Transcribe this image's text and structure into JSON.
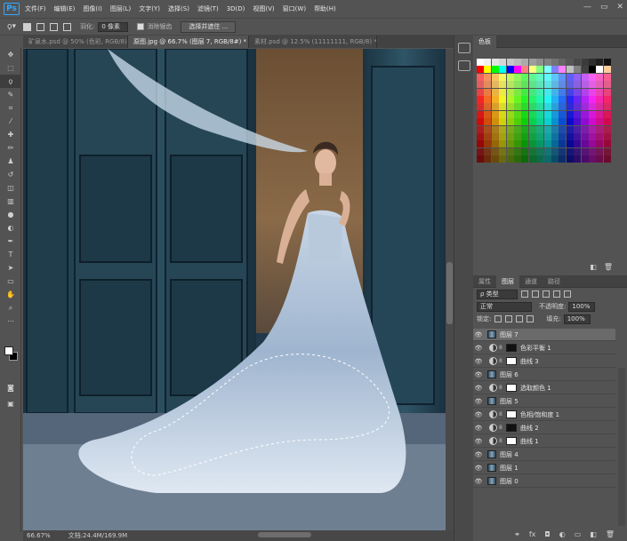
{
  "app": {
    "logo": "Ps",
    "accent": "#31a8ff"
  },
  "menu": [
    "文件(F)",
    "编辑(E)",
    "图像(I)",
    "图层(L)",
    "文字(Y)",
    "选择(S)",
    "滤镜(T)",
    "3D(D)",
    "视图(V)",
    "窗口(W)",
    "帮助(H)"
  ],
  "window_controls": {
    "minimize": "—",
    "restore": "▭",
    "close": "✕"
  },
  "options": {
    "feather_label": "羽化:",
    "feather_value": "0 像素",
    "antialias_label": "消除锯齿",
    "select_mask_button": "选择并遮住 ..."
  },
  "tabs": [
    {
      "label": "矿泉水.psd @ 50% (色彩, RGB/8) ×"
    },
    {
      "label": "原图.jpg @ 66.7% (图层 7, RGB/8#) * ×"
    },
    {
      "label": "素材.psd @ 12.5% (11111111, RGB/8) * ×"
    }
  ],
  "tools": [
    "move-icon",
    "marquee-icon",
    "lasso-icon",
    "quick-select-icon",
    "crop-icon",
    "eyedropper-icon",
    "healing-icon",
    "brush-icon",
    "stamp-icon",
    "history-brush-icon",
    "eraser-icon",
    "gradient-icon",
    "blur-icon",
    "dodge-icon",
    "pen-icon",
    "text-icon",
    "path-select-icon",
    "shape-icon",
    "hand-icon",
    "zoom-icon",
    "more-icon"
  ],
  "status": {
    "zoom": "66.67%",
    "doc": "文档:24.4M/169.9M"
  },
  "swatches_panel": {
    "tab": "色板"
  },
  "layers_panel": {
    "tabs": [
      "属性",
      "图层",
      "通道",
      "路径"
    ],
    "kind_label": "ρ 类型",
    "blend_mode": "正常",
    "opacity_label": "不透明度:",
    "opacity_value": "100%",
    "lock_label": "锁定:",
    "fill_label": "填充:",
    "fill_value": "100%",
    "layers": [
      {
        "name": "图层 7",
        "type": "pixel",
        "selected": true
      },
      {
        "name": "色彩平衡 1",
        "type": "adjust",
        "selected": false
      },
      {
        "name": "曲线 3",
        "type": "adjust",
        "selected": false
      },
      {
        "name": "图层 6",
        "type": "pixel",
        "selected": false
      },
      {
        "name": "选取颜色 1",
        "type": "adjust",
        "selected": false
      },
      {
        "name": "图层 5",
        "type": "pixel",
        "selected": false
      },
      {
        "name": "色相/饱和度 1",
        "type": "adjust",
        "selected": false
      },
      {
        "name": "曲线 2",
        "type": "adjust",
        "selected": false
      },
      {
        "name": "曲线 1",
        "type": "adjust",
        "selected": false
      },
      {
        "name": "图层 4",
        "type": "pixel",
        "selected": false
      },
      {
        "name": "图层 1",
        "type": "pixel",
        "selected": false
      },
      {
        "name": "图层 0",
        "type": "pixel",
        "selected": false
      }
    ],
    "footer_icons": [
      "link-icon",
      "fx-icon",
      "mask-icon",
      "adjust-icon",
      "folder-icon",
      "new-layer-icon",
      "trash-icon"
    ]
  }
}
